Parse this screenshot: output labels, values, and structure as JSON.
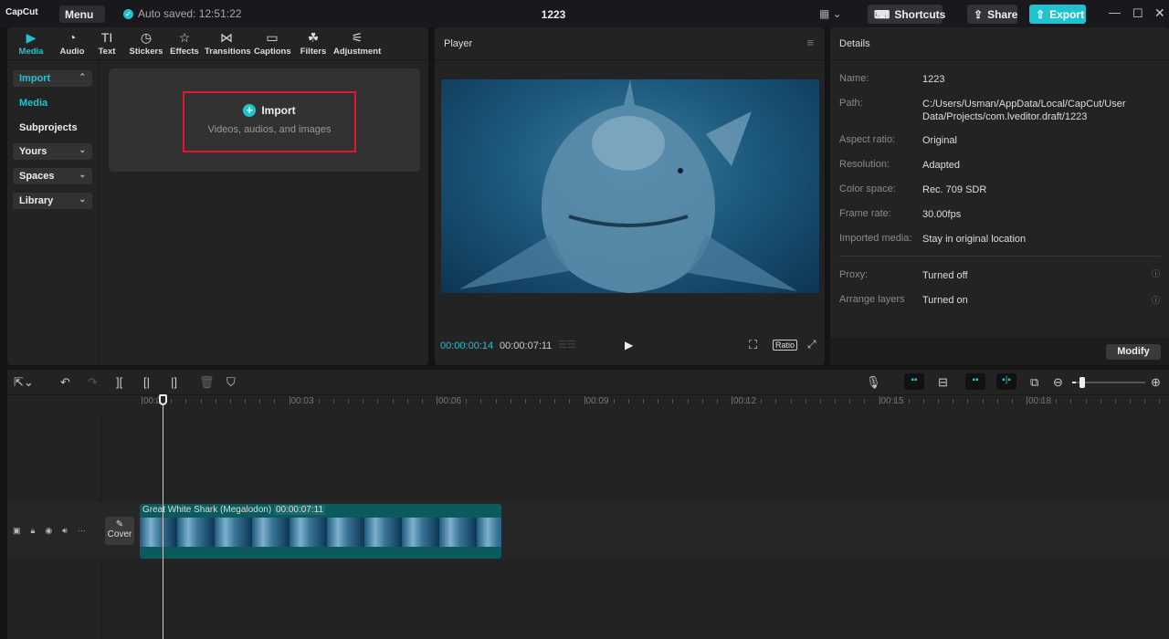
{
  "titlebar": {
    "app_name": "CapCut",
    "menu": "Menu",
    "autosave": "Auto saved: 12:51:22",
    "project_title": "1223",
    "shortcuts": "Shortcuts",
    "share": "Share",
    "export": "Export"
  },
  "media_tabs": [
    {
      "label": "Media",
      "icon": "media-icon"
    },
    {
      "label": "Audio",
      "icon": "audio-icon"
    },
    {
      "label": "Text",
      "icon": "text-icon"
    },
    {
      "label": "Stickers",
      "icon": "stickers-icon"
    },
    {
      "label": "Effects",
      "icon": "effects-icon"
    },
    {
      "label": "Transitions",
      "icon": "transitions-icon"
    },
    {
      "label": "Captions",
      "icon": "captions-icon"
    },
    {
      "label": "Filters",
      "icon": "filters-icon"
    },
    {
      "label": "Adjustment",
      "icon": "adjustment-icon"
    }
  ],
  "sidebar": [
    {
      "label": "Import"
    },
    {
      "label": "Media"
    },
    {
      "label": "Subprojects"
    },
    {
      "label": "Yours"
    },
    {
      "label": "Spaces"
    },
    {
      "label": "Library"
    }
  ],
  "import": {
    "label": "Import",
    "sub": "Videos, audios, and images"
  },
  "player": {
    "title": "Player",
    "current_time": "00:00:00:14",
    "duration": "00:00:07:11",
    "ratio": "Ratio"
  },
  "details": {
    "title": "Details",
    "rows": [
      {
        "k": "Name:",
        "v": "1223"
      },
      {
        "k": "Path:",
        "v": "C:/Users/Usman/AppData/Local/CapCut/User Data/Projects/com.lveditor.draft/1223"
      },
      {
        "k": "Aspect ratio:",
        "v": "Original"
      },
      {
        "k": "Resolution:",
        "v": "Adapted"
      },
      {
        "k": "Color space:",
        "v": "Rec. 709 SDR"
      },
      {
        "k": "Frame rate:",
        "v": "30.00fps"
      },
      {
        "k": "Imported media:",
        "v": "Stay in original location"
      },
      {
        "k": "Proxy:",
        "v": "Turned off"
      },
      {
        "k": "Arrange layers",
        "v": "Turned on"
      }
    ],
    "modify": "Modify"
  },
  "timeline": {
    "ruler": [
      "00:00",
      "00:03",
      "00:06",
      "00:09",
      "00:12",
      "00:15",
      "00:18"
    ],
    "cover": "Cover",
    "clip_name": "Great White Shark (Megalodon)",
    "clip_duration": "00:00:07:11",
    "zoom_level": 0.05
  },
  "colors": {
    "accent": "#1fc3d0",
    "clip": "#0b5a5c",
    "highlight_box": "#e0192a"
  }
}
